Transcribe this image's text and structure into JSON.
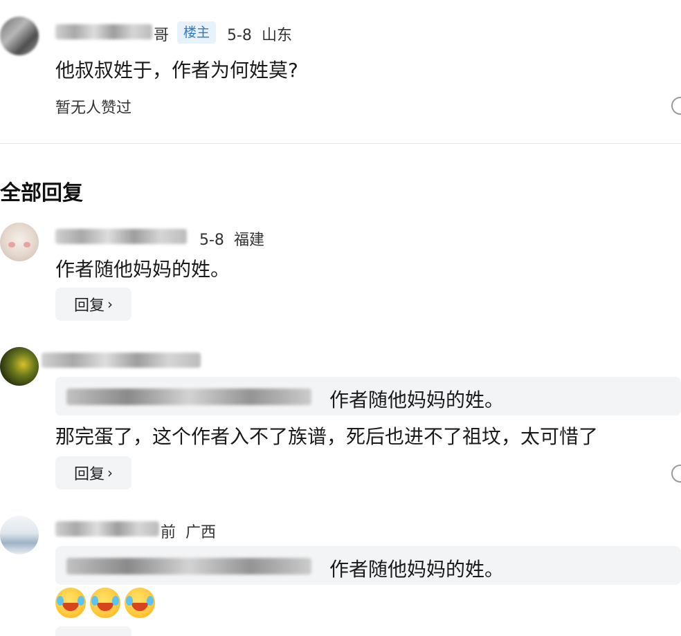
{
  "op": {
    "name_suffix": "哥",
    "badge": "楼主",
    "date": "5-8",
    "location": "山东",
    "text": "他叔叔姓于，作者为何姓莫?",
    "likes": "暂无人赞过"
  },
  "section_title": "全部回复",
  "replies": [
    {
      "date": "5-8",
      "location": "福建",
      "text": "作者随他妈妈的姓。",
      "reply_label": "回复",
      "reply_chevron": "›"
    },
    {
      "quote_text": "作者随他妈妈的姓。",
      "text": "那完蛋了，这个作者入不了族谱，死后也进不了祖坟，太可惜了",
      "reply_label": "回复",
      "reply_chevron": "›"
    },
    {
      "time": "前",
      "location": "广西",
      "quote_text": "作者随他妈妈的姓。",
      "emoji_count": "3"
    }
  ],
  "icons": {
    "reply_chevron": "chevron-right-icon",
    "edge": "more-circle-icon",
    "emoji": "laughing-tears-emoji-icon"
  },
  "colors": {
    "badge_bg": "#e8f2fd",
    "badge_text": "#2e78c8",
    "button_bg": "#f3f4f6"
  }
}
